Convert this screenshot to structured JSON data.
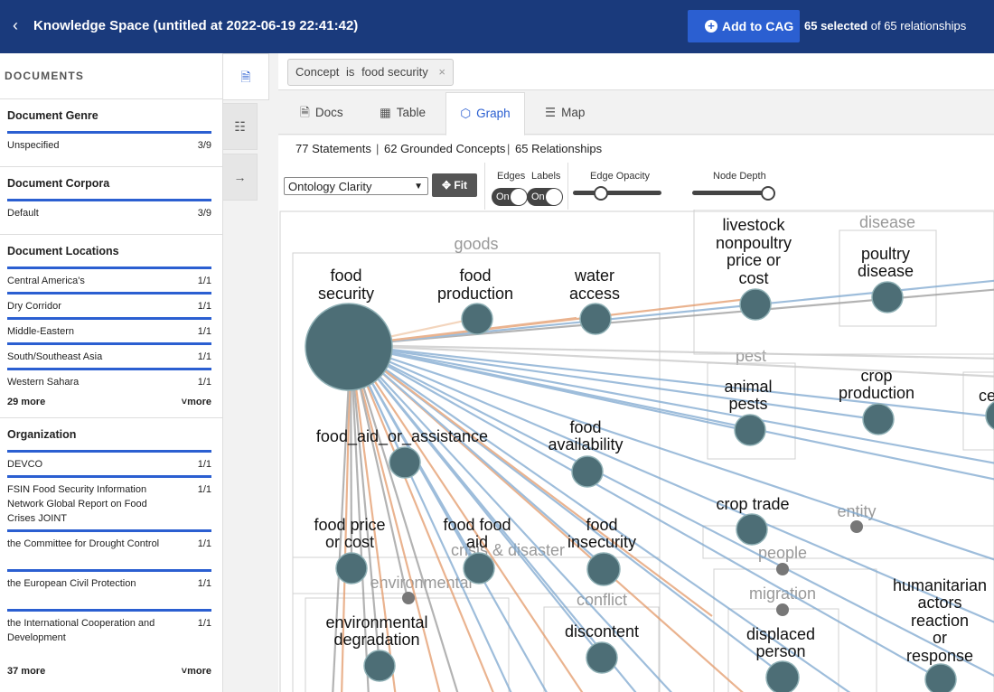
{
  "header": {
    "back_icon": "chevron-left-icon",
    "title": "Knowledge Space (untitled at 2022-06-19 22:41:42)",
    "add_button": "Add to CAG",
    "selected_count": "65 selected",
    "selected_suffix": "of 65 relationships"
  },
  "sidebar": {
    "title": "DOCUMENTS",
    "sections": {
      "genre": {
        "title": "Document Genre",
        "items": [
          {
            "label": "Unspecified",
            "count": "3/9"
          }
        ]
      },
      "corpora": {
        "title": "Document Corpora",
        "items": [
          {
            "label": "Default",
            "count": "3/9"
          }
        ]
      },
      "locations": {
        "title": "Document Locations",
        "items": [
          {
            "label": "Central America's",
            "count": "1/1"
          },
          {
            "label": "Dry Corridor",
            "count": "1/1"
          },
          {
            "label": "Middle-Eastern",
            "count": "1/1"
          },
          {
            "label": "South/Southeast Asia",
            "count": "1/1"
          },
          {
            "label": "Western Sahara",
            "count": "1/1"
          }
        ],
        "more_count": "29 more",
        "more_link": "more"
      },
      "organization": {
        "title": "Organization",
        "items": [
          {
            "label": "DEVCO",
            "count": "1/1"
          },
          {
            "label": "FSIN Food Security Information Network Global Report on Food Crises JOINT",
            "count": "1/1"
          },
          {
            "label": "the Committee for Drought Control",
            "count": "1/1"
          },
          {
            "label": "the European Civil Protection",
            "count": "1/1"
          },
          {
            "label": "the International Cooperation and Development",
            "count": "1/1"
          }
        ],
        "more_count": "37 more",
        "more_link": "more"
      }
    }
  },
  "filter": {
    "field": "Concept",
    "op": "is",
    "value": "food security",
    "remove": "×"
  },
  "tabs": [
    {
      "label": "Docs",
      "icon": "document-icon"
    },
    {
      "label": "Table",
      "icon": "table-icon"
    },
    {
      "label": "Graph",
      "icon": "graph-icon",
      "active": true
    },
    {
      "label": "Map",
      "icon": "map-icon"
    }
  ],
  "stats": {
    "statements": "77 Statements",
    "concepts": "62 Grounded Concepts",
    "relationships": "65 Relationships",
    "sep": "|"
  },
  "controls": {
    "layout_select": "Ontology Clarity",
    "fit_button": "Fit",
    "edges_label": "Edges",
    "labels_label": "Labels",
    "edges_toggle": "On",
    "labels_toggle": "On",
    "edge_opacity_label": "Edge Opacity",
    "node_depth_label": "Node Depth",
    "edge_opacity_value": 0.3,
    "node_depth_value": 1.0
  },
  "graph": {
    "groups": [
      "goods",
      "disease",
      "pest",
      "crisis & disaster",
      "environmental",
      "conflict",
      "entity",
      "people",
      "migration"
    ],
    "nodes": [
      {
        "label": [
          "food",
          "security"
        ]
      },
      {
        "label": [
          "food",
          "production"
        ]
      },
      {
        "label": [
          "water",
          "access"
        ]
      },
      {
        "label": [
          "livestock",
          "nonpoultry",
          "price or",
          "cost"
        ]
      },
      {
        "label": [
          "poultry",
          "disease"
        ]
      },
      {
        "label": [
          "animal",
          "pests"
        ]
      },
      {
        "label": [
          "crop",
          "production"
        ]
      },
      {
        "label": [
          "ce"
        ]
      },
      {
        "label": [
          "food_aid_or_assistance"
        ]
      },
      {
        "label": [
          "food",
          "availability"
        ]
      },
      {
        "label": [
          "crop trade"
        ]
      },
      {
        "label": [
          "food price",
          "or cost"
        ]
      },
      {
        "label": [
          "food food",
          "aid"
        ]
      },
      {
        "label": [
          "food",
          "insecurity"
        ]
      },
      {
        "label": [
          "environmental",
          "degradation"
        ]
      },
      {
        "label": [
          "discontent"
        ]
      },
      {
        "label": [
          "displaced",
          "person"
        ]
      },
      {
        "label": [
          "humanitarian",
          "actors",
          "reaction",
          "or",
          "response"
        ]
      }
    ],
    "colors": {
      "node": "#4d6e76",
      "edge_blue": "#7ea8cf",
      "edge_orange": "#e39a6a",
      "edge_gray": "#9a9a9a",
      "hub": "#3d6870"
    }
  }
}
